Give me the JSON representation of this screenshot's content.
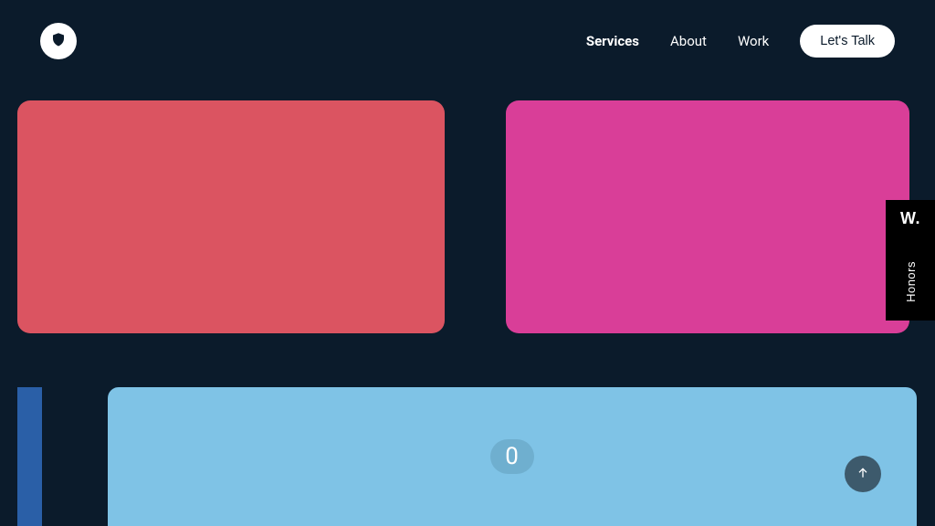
{
  "nav": {
    "items": [
      {
        "label": "Services",
        "active": true
      },
      {
        "label": "About",
        "active": false
      },
      {
        "label": "Work",
        "active": false
      }
    ],
    "cta_label": "Let's Talk"
  },
  "cards": {
    "left_color": "#db5461",
    "right_color": "#d93e98"
  },
  "stats": {
    "pill_value": "0"
  },
  "badge": {
    "mark": "W.",
    "label": "Honors"
  },
  "colors": {
    "bg": "#0b1b2b",
    "strip_bar": "#2a5fa7",
    "strip_main": "#7fc3e6",
    "pill_bg": "#6fafcf",
    "fab_bg": "#3d5a6c"
  }
}
